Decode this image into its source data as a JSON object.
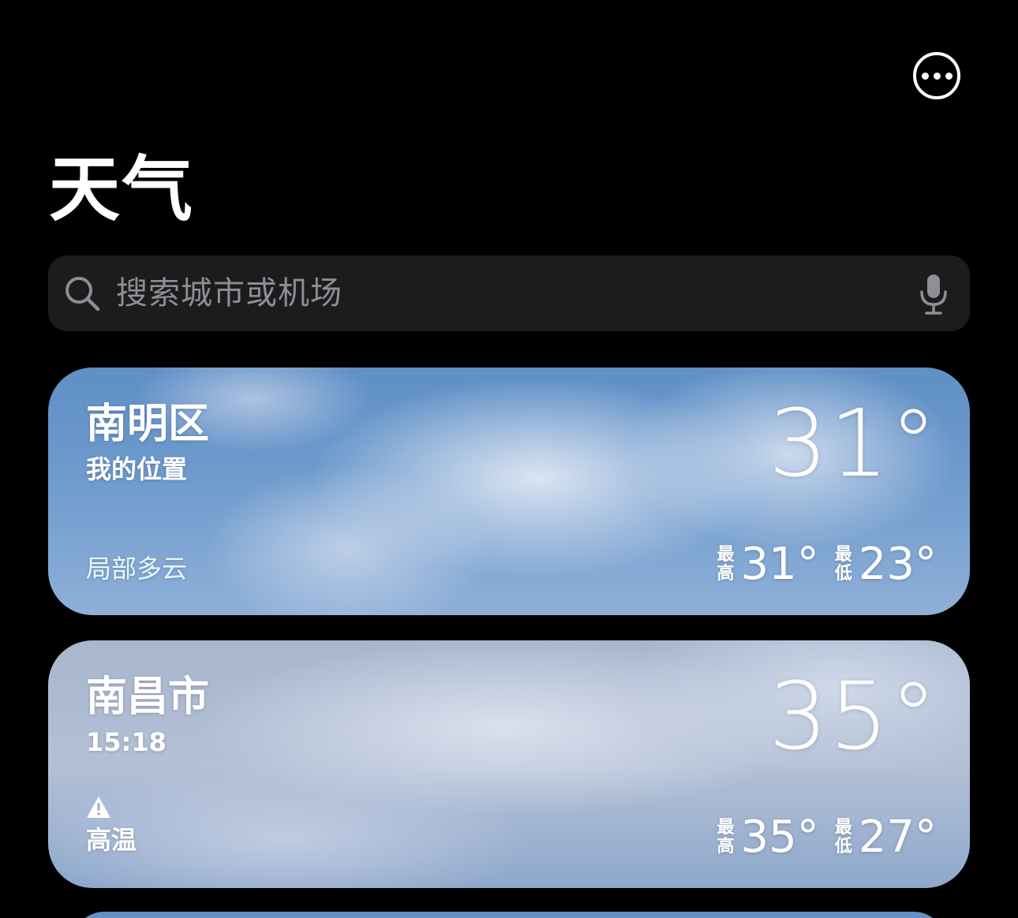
{
  "header": {
    "title": "天气",
    "more_icon": "ellipsis-circle-icon"
  },
  "search": {
    "placeholder": "搜索城市或机场",
    "search_icon": "magnifying-glass-icon",
    "mic_icon": "microphone-icon"
  },
  "locations": [
    {
      "name": "南明区",
      "subtitle": "我的位置",
      "temperature": "31°",
      "condition": "局部多云",
      "high_label_top": "最",
      "high_label_bottom": "高",
      "high": "31°",
      "low_label_top": "最",
      "low_label_bottom": "低",
      "low": "23°"
    },
    {
      "name": "南昌市",
      "subtitle": "15:18",
      "temperature": "35°",
      "alert": "高温",
      "alert_icon": "warning-triangle-icon",
      "high_label_top": "最",
      "high_label_bottom": "高",
      "high": "35°",
      "low_label_top": "最",
      "low_label_bottom": "低",
      "low": "27°"
    }
  ],
  "colors": {
    "background": "#000000",
    "search_bg": "#1c1c1e",
    "placeholder": "#8e8e93",
    "condition_text": "#e8f7ff"
  }
}
